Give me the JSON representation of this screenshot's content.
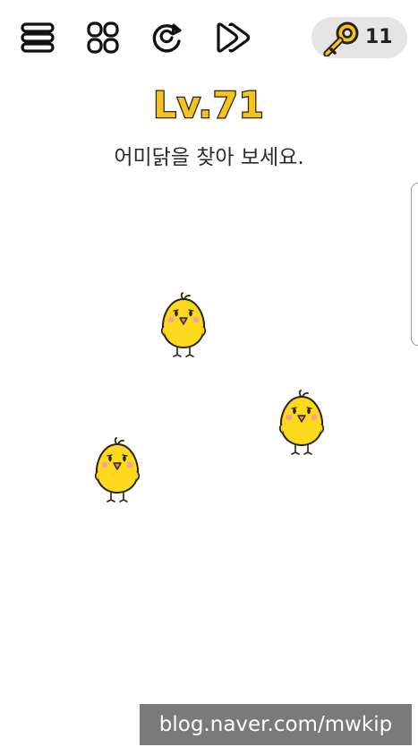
{
  "toolbar": {
    "icons": [
      "menu-icon",
      "levels-grid-icon",
      "restart-icon",
      "skip-icon"
    ]
  },
  "keys": {
    "icon": "key-icon",
    "count": "11"
  },
  "level": {
    "title": "Lv.71"
  },
  "question": {
    "text": "어미닭을 찾아 보세요."
  },
  "chicks": [
    "chick-icon",
    "chick-icon",
    "chick-icon"
  ],
  "watermark": {
    "text": "blog.naver.com/mwkip"
  },
  "colors": {
    "level_fill": "#f6c21c",
    "level_stroke": "#2a2014",
    "chick_body": "#fcd91c",
    "key_pill_bg": "#e5e5e5",
    "watermark_bg": "#7a7a7a"
  }
}
